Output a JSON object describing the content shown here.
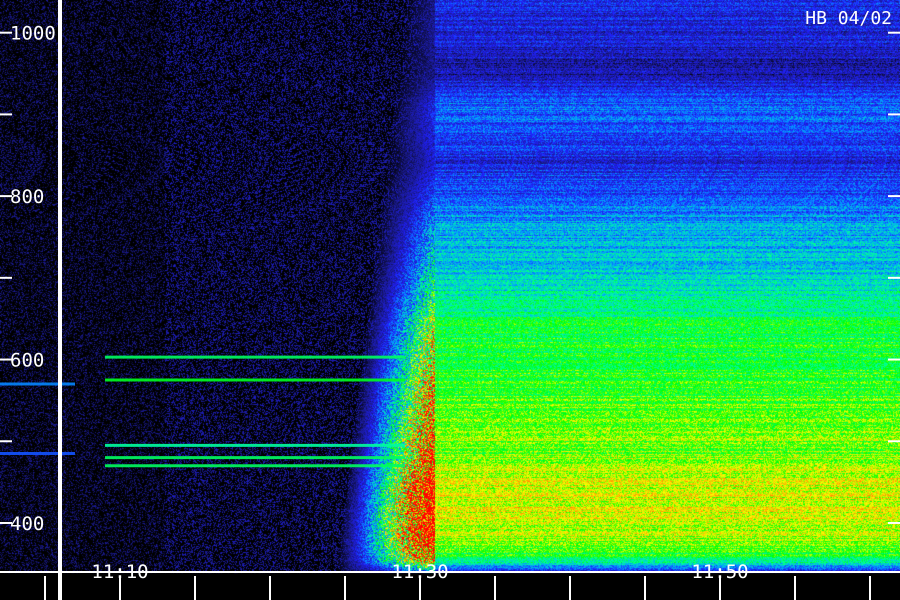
{
  "chart_data": {
    "type": "heatmap",
    "title": "HB 04/02",
    "xlabel": "",
    "ylabel": "",
    "ylim": [
      340,
      1040
    ],
    "y_ticks": [
      {
        "value": 1000,
        "label": "1000"
      },
      {
        "value": 900,
        "label": ""
      },
      {
        "value": 800,
        "label": "800"
      },
      {
        "value": 700,
        "label": ""
      },
      {
        "value": 600,
        "label": "600"
      },
      {
        "value": 500,
        "label": ""
      },
      {
        "value": 400,
        "label": "400"
      }
    ],
    "xlim": [
      "11:02",
      "11:62"
    ],
    "x_ticks": [
      {
        "value": "11:10",
        "label": "11:10"
      },
      {
        "value": "11:30",
        "label": "11:30"
      },
      {
        "value": "11:50",
        "label": "11:50"
      }
    ],
    "x_minor_ticks": [
      "11:05",
      "11:10",
      "11:15",
      "11:20",
      "11:25",
      "11:30",
      "11:35",
      "11:40",
      "11:45",
      "11:50",
      "11:55",
      "11:60"
    ],
    "colorscale": [
      "#000000",
      "#1a1a8c",
      "#2020ff",
      "#00a0ff",
      "#00ffa0",
      "#00ff00",
      "#ffff00",
      "#ff8000",
      "#ff0000"
    ],
    "emission_lines": [
      {
        "frequency": 603,
        "start": "11:09",
        "end": "11:29",
        "intensity": 0.55
      },
      {
        "frequency": 575,
        "start": "11:09",
        "end": "11:29",
        "intensity": 0.6
      },
      {
        "frequency": 570,
        "start": "11:02",
        "end": "11:07",
        "intensity": 0.35
      },
      {
        "frequency": 495,
        "start": "11:09",
        "end": "11:29",
        "intensity": 0.5
      },
      {
        "frequency": 480,
        "start": "11:09",
        "end": "11:29",
        "intensity": 0.55
      },
      {
        "frequency": 470,
        "start": "11:09",
        "end": "11:29",
        "intensity": 0.55
      },
      {
        "frequency": 485,
        "start": "11:02",
        "end": "11:07",
        "intensity": 0.3
      }
    ],
    "burst": {
      "start": "11:31",
      "end": "11:62",
      "onset_frequency_low": 340,
      "onset_frequency_high": 1040
    },
    "burst_profile": [
      {
        "frequency": 1040,
        "intensity": 0.22
      },
      {
        "frequency": 990,
        "intensity": 0.2
      },
      {
        "frequency": 950,
        "intensity": 0.15
      },
      {
        "frequency": 910,
        "intensity": 0.32
      },
      {
        "frequency": 880,
        "intensity": 0.28
      },
      {
        "frequency": 840,
        "intensity": 0.22
      },
      {
        "frequency": 800,
        "intensity": 0.3
      },
      {
        "frequency": 760,
        "intensity": 0.38
      },
      {
        "frequency": 720,
        "intensity": 0.42
      },
      {
        "frequency": 680,
        "intensity": 0.48
      },
      {
        "frequency": 640,
        "intensity": 0.58
      },
      {
        "frequency": 600,
        "intensity": 0.6
      },
      {
        "frequency": 560,
        "intensity": 0.64
      },
      {
        "frequency": 520,
        "intensity": 0.66
      },
      {
        "frequency": 480,
        "intensity": 0.68
      },
      {
        "frequency": 440,
        "intensity": 0.76
      },
      {
        "frequency": 410,
        "intensity": 0.74
      },
      {
        "frequency": 380,
        "intensity": 0.7
      },
      {
        "frequency": 355,
        "intensity": 0.55
      },
      {
        "frequency": 340,
        "intensity": 0.2
      }
    ],
    "grid": false,
    "legend": "none"
  }
}
